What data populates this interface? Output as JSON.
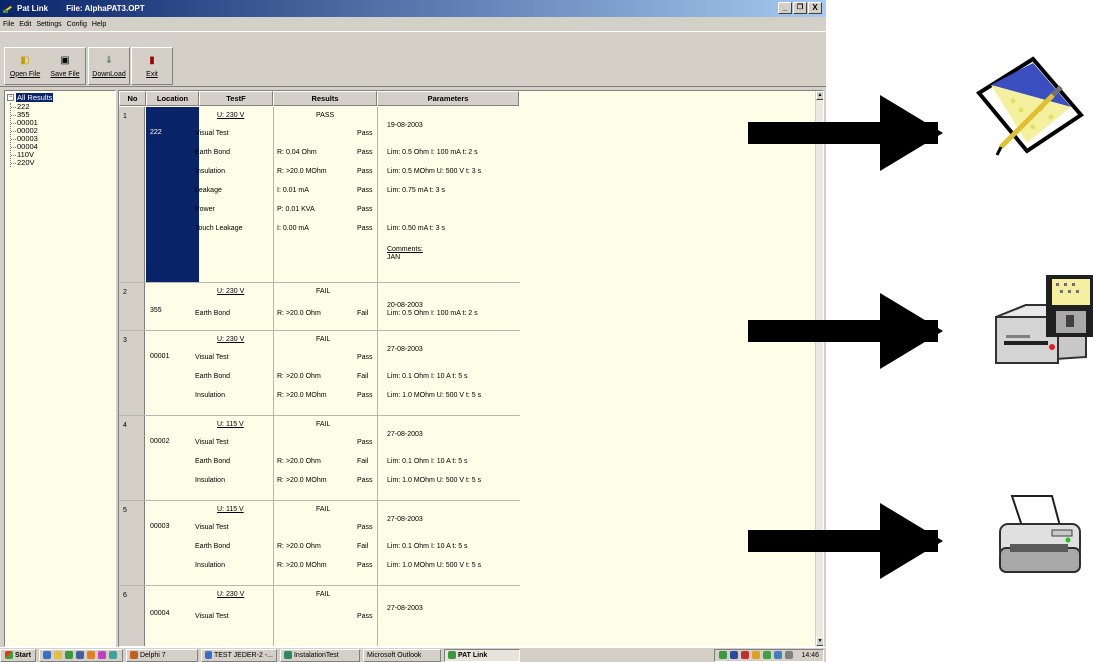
{
  "window": {
    "app_name": "Pat Link",
    "file_label": "File: AlphaPAT3.OPT",
    "buttons": [
      "_",
      "щ",
      "X"
    ]
  },
  "menu": [
    "File",
    "Edit",
    "Settings",
    "Config",
    "Help"
  ],
  "toolbar": {
    "open_file": "Open File",
    "save_file": "Save File",
    "download": "DownLoad",
    "exit": "Exit"
  },
  "tree": {
    "root": "All Results",
    "children": [
      "222",
      "355",
      "00001",
      "00002",
      "00003",
      "00004",
      "110V",
      "220V"
    ]
  },
  "table": {
    "headers": [
      "No",
      "Location",
      "TestF",
      "Results",
      "Parameters"
    ],
    "records": [
      {
        "no": "1",
        "location": "222",
        "voltage": "U: 230 V",
        "status": "PASS",
        "date": "19-08-2003",
        "tests": [
          {
            "name": "Visual Test",
            "value": "",
            "result": "Pass",
            "param": ""
          },
          {
            "name": "Earth Bond",
            "value": "R: 0.04 Ohm",
            "result": "Pass",
            "param": "Lim: 0.5 Ohm  I: 100 mA  t: 2 s"
          },
          {
            "name": "Insulation",
            "value": "R: >20.0 MOhm",
            "result": "Pass",
            "param": "Lim: 0.5 MOhm  U: 500 V  t: 3 s"
          },
          {
            "name": "Leakage",
            "value": "I: 0.01 mA",
            "result": "Pass",
            "param": "Lim: 0.75 mA  t: 3 s"
          },
          {
            "name": "Power",
            "value": "P: 0.01 KVA",
            "result": "Pass",
            "param": ""
          },
          {
            "name": "Touch Leakage",
            "value": "I: 0.00 mA",
            "result": "Pass",
            "param": "Lim: 0.50 mA  t: 3 s"
          }
        ],
        "comments_label": "Comments:",
        "comments": "JAN"
      },
      {
        "no": "2",
        "location": "355",
        "voltage": "U: 230 V",
        "status": "FAIL",
        "date": "20-08-2003",
        "tests": [
          {
            "name": "Earth Bond",
            "value": "R: >20.0 Ohm",
            "result": "Fail",
            "param": "Lim: 0.5 Ohm  I: 100 mA  t: 2 s"
          }
        ]
      },
      {
        "no": "3",
        "location": "00001",
        "voltage": "U: 230 V",
        "status": "FAIL",
        "date": "27-08-2003",
        "tests": [
          {
            "name": "Visual Test",
            "value": "",
            "result": "Pass",
            "param": ""
          },
          {
            "name": "Earth Bond",
            "value": "R: >20.0 Ohm",
            "result": "Fail",
            "param": "Lim: 0.1 Ohm  I: 10 A  t: 5 s"
          },
          {
            "name": "Insulation",
            "value": "R: >20.0 MOhm",
            "result": "Pass",
            "param": "Lim: 1.0 MOhm  U: 500 V  t: 5 s"
          }
        ]
      },
      {
        "no": "4",
        "location": "00002",
        "voltage": "U: 115 V",
        "status": "FAIL",
        "date": "27-08-2003",
        "tests": [
          {
            "name": "Visual Test",
            "value": "",
            "result": "Pass",
            "param": ""
          },
          {
            "name": "Earth Bond",
            "value": "R: >20.0 Ohm",
            "result": "Fail",
            "param": "Lim: 0.1 Ohm  I: 10 A  t: 5 s"
          },
          {
            "name": "Insulation",
            "value": "R: >20.0 MOhm",
            "result": "Pass",
            "param": "Lim: 1.0 MOhm  U: 500 V  t: 5 s"
          }
        ]
      },
      {
        "no": "5",
        "location": "00003",
        "voltage": "U: 115 V",
        "status": "FAIL",
        "date": "27-08-2003",
        "tests": [
          {
            "name": "Visual Test",
            "value": "",
            "result": "Pass",
            "param": ""
          },
          {
            "name": "Earth Bond",
            "value": "R: >20.0 Ohm",
            "result": "Fail",
            "param": "Lim: 0.1 Ohm  I: 10 A  t: 5 s"
          },
          {
            "name": "Insulation",
            "value": "R: >20.0 MOhm",
            "result": "Pass",
            "param": "Lim: 1.0 MOhm  U: 500 V  t: 5 s"
          }
        ]
      },
      {
        "no": "6",
        "location": "00004",
        "voltage": "U: 230 V",
        "status": "FAIL",
        "date": "27-08-2003",
        "tests": [
          {
            "name": "Visual Test",
            "value": "",
            "result": "Pass",
            "param": ""
          }
        ]
      }
    ]
  },
  "taskbar": {
    "start": "Start",
    "items": [
      "Delphi 7",
      "TEST JEDER-2 -...",
      "InstalationTest",
      "Microsoft Outlook",
      "PAT Link"
    ],
    "active": "PAT Link",
    "clock": "14:46"
  },
  "icons": {
    "top": "envelope-edit-icon",
    "middle": "disk-drive-icon",
    "bottom": "printer-icon"
  },
  "colors": {
    "title_gradient_start": "#0a246a",
    "selection": "#0a246a",
    "pane_background": "#fdfde8",
    "window_face": "#d4d0c8"
  }
}
